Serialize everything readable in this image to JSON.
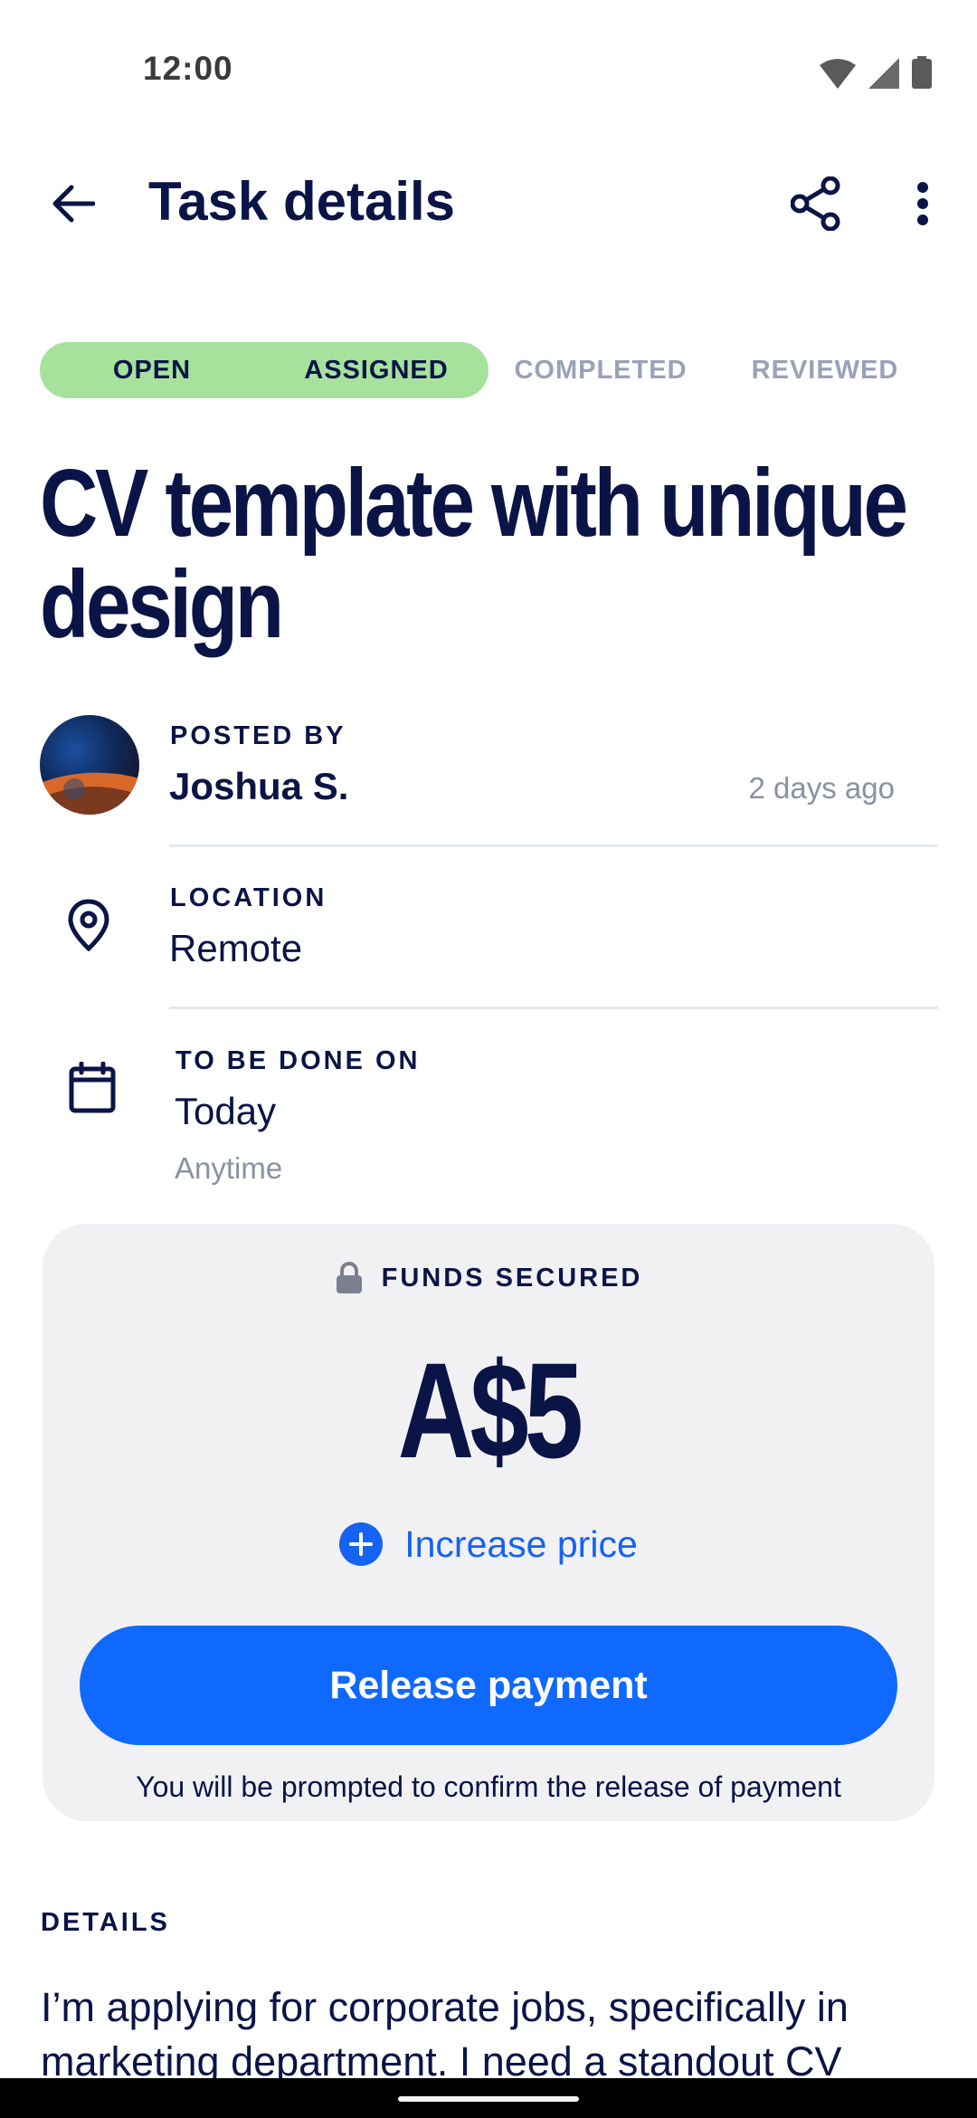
{
  "status_bar": {
    "time": "12:00"
  },
  "app_bar": {
    "title": "Task details"
  },
  "progress": {
    "steps": [
      "OPEN",
      "ASSIGNED",
      "COMPLETED",
      "REVIEWED"
    ],
    "completed_steps": 2,
    "fill_color": "#a6e29c"
  },
  "task": {
    "title": "CV template with unique design"
  },
  "poster": {
    "label": "POSTED BY",
    "name": "Joshua S.",
    "time_ago": "2 days ago"
  },
  "location": {
    "label": "LOCATION",
    "value": "Remote"
  },
  "schedule": {
    "label": "TO BE DONE ON",
    "value": "Today",
    "sub": "Anytime"
  },
  "funds": {
    "label": "FUNDS SECURED",
    "amount": "A$5",
    "increase_label": "Increase price",
    "release_label": "Release payment",
    "note": "You will be prompted to confirm the release of payment"
  },
  "details": {
    "label": "DETAILS",
    "text": "I’m applying for corporate jobs, specifically in marketing department. I need a standout CV"
  },
  "colors": {
    "primary": "#0f69ff",
    "text": "#0b1446",
    "card": "#f1f1f4"
  }
}
